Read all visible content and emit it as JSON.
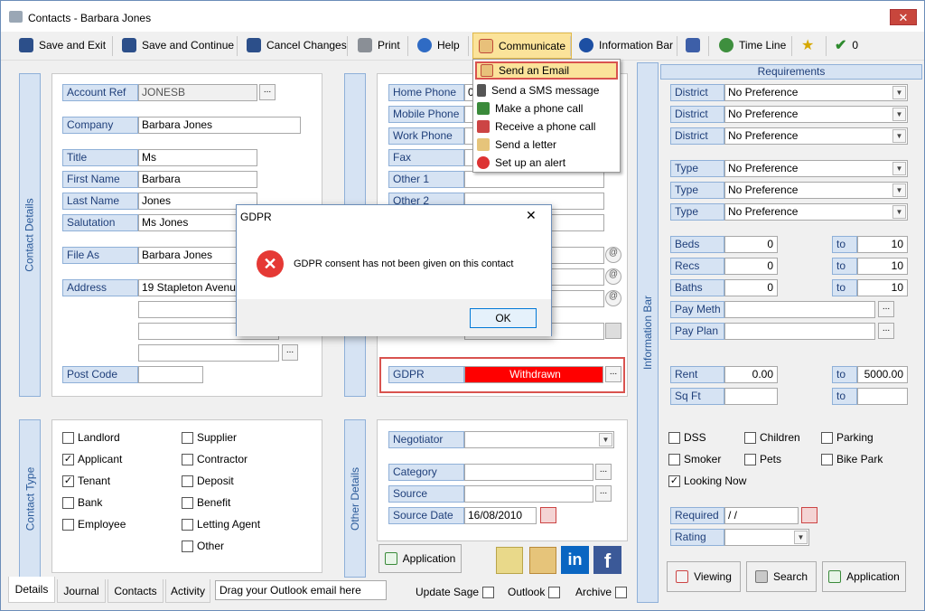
{
  "window": {
    "title": "Contacts  - Barbara Jones",
    "close_glyph": "✕"
  },
  "toolbar": {
    "save_exit": "Save and Exit",
    "save_continue": "Save and Continue",
    "cancel": "Cancel Changes",
    "print": "Print",
    "help": "Help",
    "communicate": "Communicate",
    "info_bar": "Information Bar",
    "time_line": "Time Line",
    "count": "0"
  },
  "side_tabs": {
    "contact_details": "Contact Details",
    "contact_type": "Contact Type",
    "other_details": "Other Details",
    "information_bar": "Information Bar",
    "middle_partial": "e"
  },
  "contact": {
    "account_ref_label": "Account Ref",
    "account_ref": "JONESB",
    "company_label": "Company",
    "company": "Barbara Jones",
    "title_label": "Title",
    "title": "Ms",
    "first_name_label": "First Name",
    "first_name": "Barbara",
    "last_name_label": "Last Name",
    "last_name": "Jones",
    "salutation_label": "Salutation",
    "salutation": "Ms Jones",
    "file_as_label": "File As",
    "file_as": "Barbara Jones",
    "address_label": "Address",
    "address1": "19 Stapleton Avenu",
    "postcode_label": "Post Code",
    "dots": "..."
  },
  "phones": {
    "home_label": "Home Phone",
    "home": "0",
    "mobile_label": "Mobile Phone",
    "work_label": "Work Phone",
    "fax_label": "Fax",
    "other1_label": "Other 1",
    "other2_label": "Other 2",
    "gdpr_label": "GDPR",
    "gdpr_value": "Withdrawn",
    "at": "@"
  },
  "contact_type": {
    "items": [
      {
        "label": "Landlord",
        "checked": false
      },
      {
        "label": "Applicant",
        "checked": true
      },
      {
        "label": "Tenant",
        "checked": true
      },
      {
        "label": "Bank",
        "checked": false
      },
      {
        "label": "Employee",
        "checked": false
      },
      {
        "label": "Supplier",
        "checked": false
      },
      {
        "label": "Contractor",
        "checked": false
      },
      {
        "label": "Deposit",
        "checked": false
      },
      {
        "label": "Benefit",
        "checked": false
      },
      {
        "label": "Letting Agent",
        "checked": false
      },
      {
        "label": "Other",
        "checked": false
      }
    ],
    "check": "✓"
  },
  "other": {
    "negotiator_label": "Negotiator",
    "category_label": "Category",
    "source_label": "Source",
    "source_date_label": "Source Date",
    "source_date": "16/08/2010",
    "application_btn": "Application"
  },
  "requirements": {
    "header": "Requirements",
    "district_label": "District",
    "type_label": "Type",
    "no_pref": "No Preference",
    "beds_label": "Beds",
    "beds_from": "0",
    "beds_to": "10",
    "recs_label": "Recs",
    "recs_from": "0",
    "recs_to": "10",
    "baths_label": "Baths",
    "baths_from": "0",
    "baths_to": "10",
    "to_label": "to",
    "pay_meth_label": "Pay Meth",
    "pay_plan_label": "Pay Plan",
    "rent_label": "Rent",
    "rent_from": "0.00",
    "rent_to": "5000.00",
    "sqft_label": "Sq Ft",
    "dss": "DSS",
    "children": "Children",
    "parking": "Parking",
    "smoker": "Smoker",
    "pets": "Pets",
    "bike_park": "Bike Park",
    "looking_now": "Looking Now",
    "required_label": "Required",
    "required_value": " / /",
    "rating_label": "Rating",
    "viewing_btn": "Viewing",
    "search_btn": "Search",
    "application_btn": "Application"
  },
  "bottom_tabs": {
    "details": "Details",
    "journal": "Journal",
    "contacts": "Contacts",
    "activity": "Activity",
    "outlook_drop": "Drag your Outlook email here",
    "update_sage": "Update Sage",
    "outlook": "Outlook",
    "archive": "Archive"
  },
  "menu": {
    "items": [
      "Send an Email",
      "Send a SMS message",
      "Make a phone call",
      "Receive a phone call",
      "Send a letter",
      "Set up an alert"
    ]
  },
  "dialog": {
    "title": "GDPR",
    "message": "GDPR consent has not been given on this contact",
    "ok": "OK",
    "close": "✕",
    "error_glyph": "✕"
  },
  "colors": {
    "label_bg": "#d6e3f3",
    "label_text": "#1f3f7a",
    "gdpr_red": "#ff0000",
    "highlight_red": "#d9534f",
    "menu_hover": "#fbe39a",
    "error_red": "#e53935"
  }
}
